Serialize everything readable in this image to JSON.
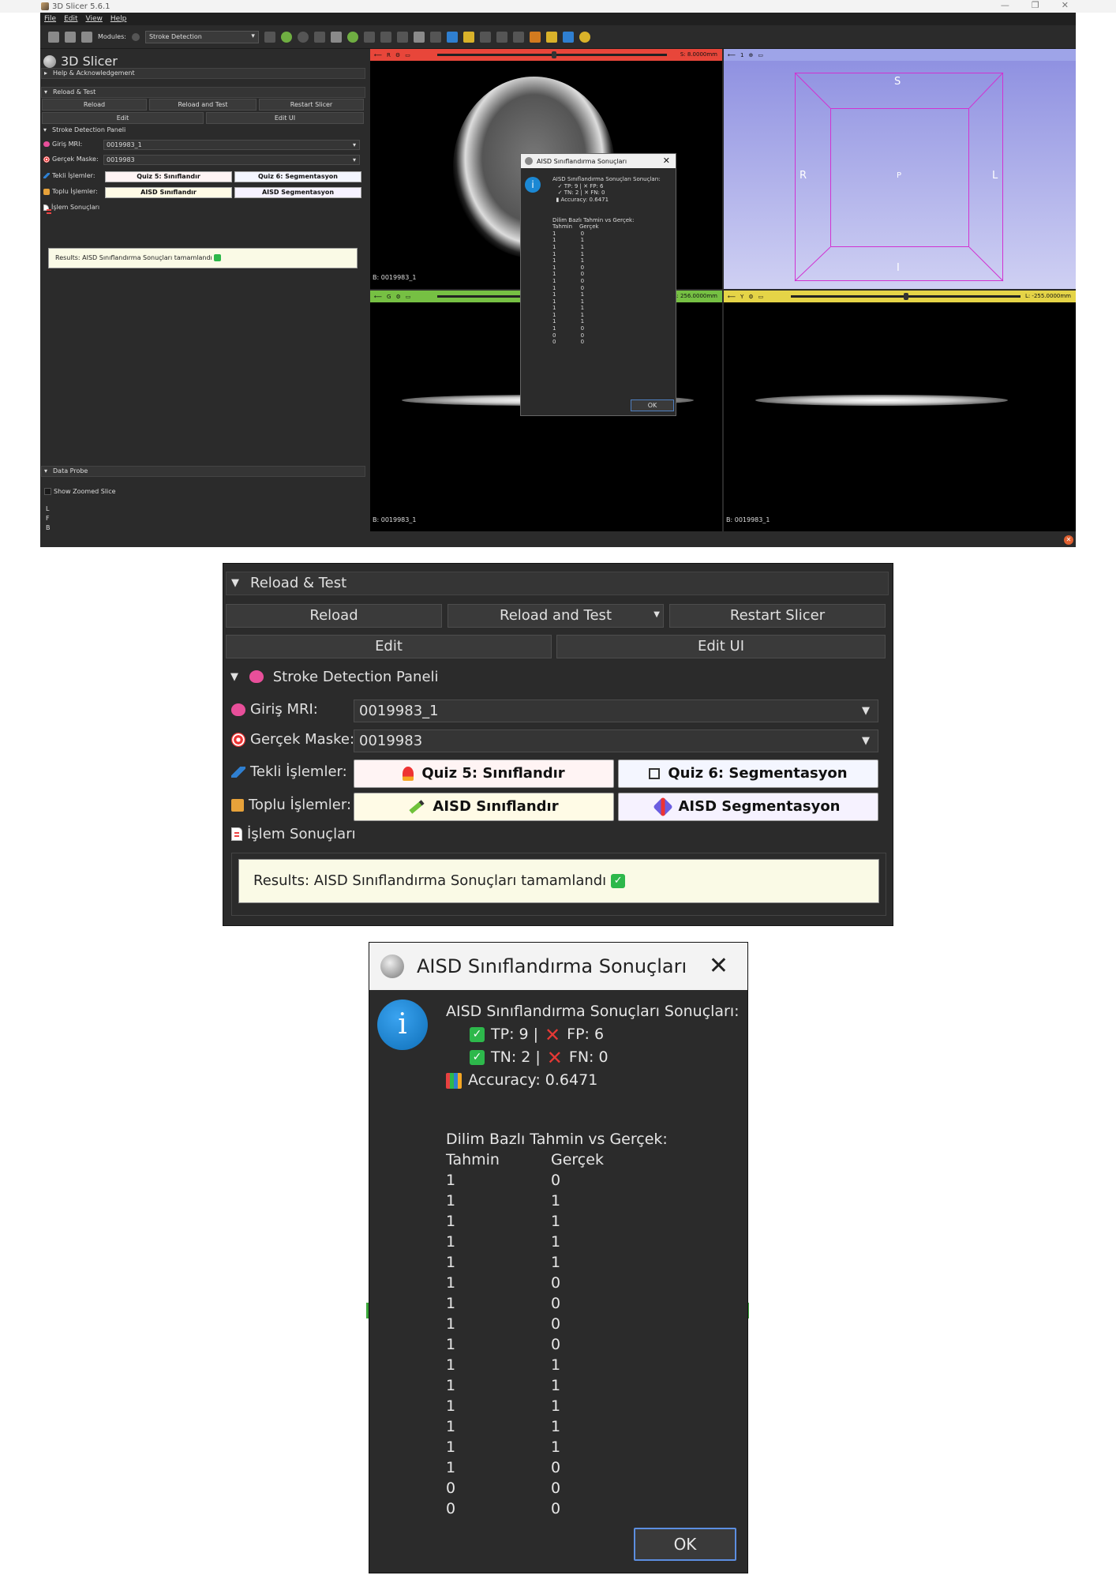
{
  "window": {
    "title": "3D Slicer 5.6.1"
  },
  "menu": [
    "File",
    "Edit",
    "View",
    "Help"
  ],
  "toolbar": {
    "modules_label": "Modules:",
    "module_value": "Stroke Detection"
  },
  "left_panel": {
    "app_title": "3D Slicer",
    "help_section": "Help & Acknowledgement",
    "reload_section": "Reload & Test",
    "reload": "Reload",
    "reload_and_test": "Reload and Test",
    "restart": "Restart Slicer",
    "edit": "Edit",
    "edit_ui": "Edit UI",
    "stroke_section": "Stroke Detection Paneli",
    "input_mri_label": "Giriş MRI:",
    "input_mri_value": "0019983_1",
    "gt_mask_label": "Gerçek Maske:",
    "gt_mask_value": "0019983",
    "single_ops_label": "Tekli İşlemler:",
    "quiz5": "Quiz 5: Sınıflandır",
    "quiz6": "Quiz 6: Segmentasyon",
    "batch_ops_label": "Toplu İşlemler:",
    "aisd_class": "AISD Sınıflandır",
    "aisd_seg": "AISD Segmentasyon",
    "results_label": "İşlem Sonuçları",
    "result_text": "Results: AISD Sınıflandırma Sonuçları tamamlandı",
    "data_probe": "Data Probe",
    "show_zoomed": "Show Zoomed Slice",
    "probe_l": "L",
    "probe_f": "F",
    "probe_b": "B"
  },
  "views": {
    "red": {
      "letter": "R",
      "offset": "S: 8.0000mm",
      "label": "B: 0019983_1"
    },
    "green": {
      "letter": "G",
      "offset": "A: 256.0000mm",
      "label": "B: 0019983_1"
    },
    "yellow": {
      "letter": "Y",
      "offset": "L: -255.0000mm",
      "label": "B: 0019983_1"
    },
    "three_d": {
      "letter": "1",
      "s": "S",
      "r": "R",
      "l": "L",
      "p": "P",
      "i": "I"
    }
  },
  "dialog": {
    "title": "AISD Sınıflandırma Sonuçları",
    "info_glyph": "i",
    "heading": "AISD Sınıflandırma Sonuçları Sonuçları:",
    "tp": "TP: 9 |",
    "fp": "FP: 6",
    "tn": "TN: 2 |",
    "fn": "FN: 0",
    "accuracy": "Accuracy: 0.6471",
    "table_title": "Dilim Bazlı Tahmin vs Gerçek:",
    "col_pred": "Tahmin",
    "col_true": "Gerçek",
    "rows": [
      [
        "1",
        "0"
      ],
      [
        "1",
        "1"
      ],
      [
        "1",
        "1"
      ],
      [
        "1",
        "1"
      ],
      [
        "1",
        "1"
      ],
      [
        "1",
        "0"
      ],
      [
        "1",
        "0"
      ],
      [
        "1",
        "0"
      ],
      [
        "1",
        "0"
      ],
      [
        "1",
        "1"
      ],
      [
        "1",
        "1"
      ],
      [
        "1",
        "1"
      ],
      [
        "1",
        "1"
      ],
      [
        "1",
        "1"
      ],
      [
        "1",
        "0"
      ],
      [
        "0",
        "0"
      ],
      [
        "0",
        "0"
      ]
    ],
    "ok": "OK"
  },
  "colors": {
    "red_bar": "#e8463a",
    "green_bar": "#76c043",
    "yellow_bar": "#e5d447",
    "blue_bar": "#9ea4e8",
    "accent_blue": "#1b88d4",
    "check_green": "#2db84b"
  }
}
